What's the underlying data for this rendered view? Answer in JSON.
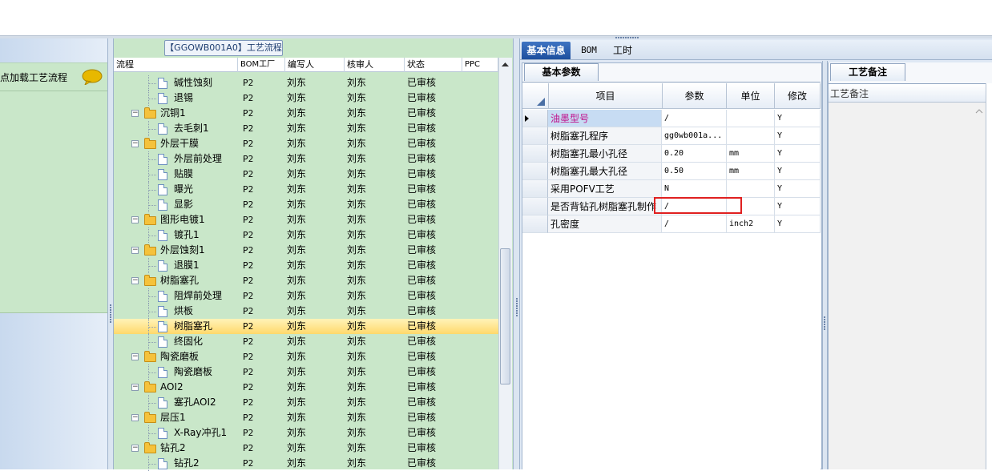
{
  "left_panel": {
    "load_process_text": "点加载工艺流程"
  },
  "tree": {
    "title": "【GGOWB001A0】工艺流程",
    "columns": [
      "流程",
      "BOM工厂",
      "编写人",
      "核审人",
      "状态",
      "PPC"
    ],
    "rows": [
      {
        "name": "碱性蚀刻",
        "level": 2,
        "type": "doc",
        "bom": "P2",
        "writer": "刘东",
        "reviewer": "刘东",
        "status": "已审核"
      },
      {
        "name": "退锡",
        "level": 2,
        "type": "doc",
        "bom": "P2",
        "writer": "刘东",
        "reviewer": "刘东",
        "status": "已审核"
      },
      {
        "name": "沉铜1",
        "level": 1,
        "type": "folder",
        "bom": "P2",
        "writer": "刘东",
        "reviewer": "刘东",
        "status": "已审核"
      },
      {
        "name": "去毛刺1",
        "level": 2,
        "type": "doc",
        "bom": "P2",
        "writer": "刘东",
        "reviewer": "刘东",
        "status": "已审核"
      },
      {
        "name": "外层干膜",
        "level": 1,
        "type": "folder",
        "bom": "P2",
        "writer": "刘东",
        "reviewer": "刘东",
        "status": "已审核"
      },
      {
        "name": "外层前处理",
        "level": 2,
        "type": "doc",
        "bom": "P2",
        "writer": "刘东",
        "reviewer": "刘东",
        "status": "已审核"
      },
      {
        "name": "贴膜",
        "level": 2,
        "type": "doc",
        "bom": "P2",
        "writer": "刘东",
        "reviewer": "刘东",
        "status": "已审核"
      },
      {
        "name": "曝光",
        "level": 2,
        "type": "doc",
        "bom": "P2",
        "writer": "刘东",
        "reviewer": "刘东",
        "status": "已审核"
      },
      {
        "name": "显影",
        "level": 2,
        "type": "doc",
        "bom": "P2",
        "writer": "刘东",
        "reviewer": "刘东",
        "status": "已审核"
      },
      {
        "name": "图形电镀1",
        "level": 1,
        "type": "folder",
        "bom": "P2",
        "writer": "刘东",
        "reviewer": "刘东",
        "status": "已审核"
      },
      {
        "name": "镀孔1",
        "level": 2,
        "type": "doc",
        "bom": "P2",
        "writer": "刘东",
        "reviewer": "刘东",
        "status": "已审核"
      },
      {
        "name": "外层蚀刻1",
        "level": 1,
        "type": "folder",
        "bom": "P2",
        "writer": "刘东",
        "reviewer": "刘东",
        "status": "已审核"
      },
      {
        "name": "退膜1",
        "level": 2,
        "type": "doc",
        "bom": "P2",
        "writer": "刘东",
        "reviewer": "刘东",
        "status": "已审核"
      },
      {
        "name": "树脂塞孔",
        "level": 1,
        "type": "folder",
        "bom": "P2",
        "writer": "刘东",
        "reviewer": "刘东",
        "status": "已审核"
      },
      {
        "name": "阻焊前处理",
        "level": 2,
        "type": "doc",
        "bom": "P2",
        "writer": "刘东",
        "reviewer": "刘东",
        "status": "已审核"
      },
      {
        "name": "烘板",
        "level": 2,
        "type": "doc",
        "bom": "P2",
        "writer": "刘东",
        "reviewer": "刘东",
        "status": "已审核"
      },
      {
        "name": "树脂塞孔",
        "level": 2,
        "type": "doc",
        "bom": "P2",
        "writer": "刘东",
        "reviewer": "刘东",
        "status": "已审核",
        "selected": true
      },
      {
        "name": "终固化",
        "level": 2,
        "type": "doc",
        "bom": "P2",
        "writer": "刘东",
        "reviewer": "刘东",
        "status": "已审核"
      },
      {
        "name": "陶瓷磨板",
        "level": 1,
        "type": "folder",
        "bom": "P2",
        "writer": "刘东",
        "reviewer": "刘东",
        "status": "已审核"
      },
      {
        "name": "陶瓷磨板",
        "level": 2,
        "type": "doc",
        "bom": "P2",
        "writer": "刘东",
        "reviewer": "刘东",
        "status": "已审核"
      },
      {
        "name": "AOI2",
        "level": 1,
        "type": "folder",
        "bom": "P2",
        "writer": "刘东",
        "reviewer": "刘东",
        "status": "已审核"
      },
      {
        "name": "塞孔AOI2",
        "level": 2,
        "type": "doc",
        "bom": "P2",
        "writer": "刘东",
        "reviewer": "刘东",
        "status": "已审核"
      },
      {
        "name": "层压1",
        "level": 1,
        "type": "folder",
        "bom": "P2",
        "writer": "刘东",
        "reviewer": "刘东",
        "status": "已审核"
      },
      {
        "name": "X-Ray冲孔1",
        "level": 2,
        "type": "doc",
        "bom": "P2",
        "writer": "刘东",
        "reviewer": "刘东",
        "status": "已审核"
      },
      {
        "name": "钻孔2",
        "level": 1,
        "type": "folder",
        "bom": "P2",
        "writer": "刘东",
        "reviewer": "刘东",
        "status": "已审核"
      },
      {
        "name": "钻孔2",
        "level": 2,
        "type": "doc",
        "bom": "P2",
        "writer": "刘东",
        "reviewer": "刘东",
        "status": "已审核"
      }
    ]
  },
  "tabs": {
    "basic_info": "基本信息",
    "bom": "BOM",
    "hours": "工时"
  },
  "params": {
    "subtab": "基本参数",
    "columns": [
      "项目",
      "参数",
      "单位",
      "修改"
    ],
    "rows": [
      {
        "item": "油墨型号",
        "param": "/",
        "unit": "",
        "modify": "Y",
        "current": true
      },
      {
        "item": "树脂塞孔程序",
        "param": "gg0wb001a...",
        "unit": "",
        "modify": "Y"
      },
      {
        "item": "树脂塞孔最小孔径",
        "param": "0.20",
        "unit": "mm",
        "modify": "Y"
      },
      {
        "item": "树脂塞孔最大孔径",
        "param": "0.50",
        "unit": "mm",
        "modify": "Y"
      },
      {
        "item": "采用POFV工艺",
        "param": "N",
        "unit": "",
        "modify": "Y"
      },
      {
        "item": "是否背钻孔树脂塞孔制作",
        "param": "/",
        "unit": "",
        "modify": "Y"
      },
      {
        "item": "孔密度",
        "param": "/",
        "unit": "inch2",
        "modify": "Y"
      }
    ]
  },
  "notes": {
    "subtab": "工艺备注",
    "column_label": "工艺备注"
  },
  "colors": {
    "tree_bg": "#c9e7c9",
    "selected_row": "#ffd96b",
    "tab_active": "#1d4f9e",
    "current_item_text": "#c0108c",
    "highlight_box": "#e02020"
  }
}
